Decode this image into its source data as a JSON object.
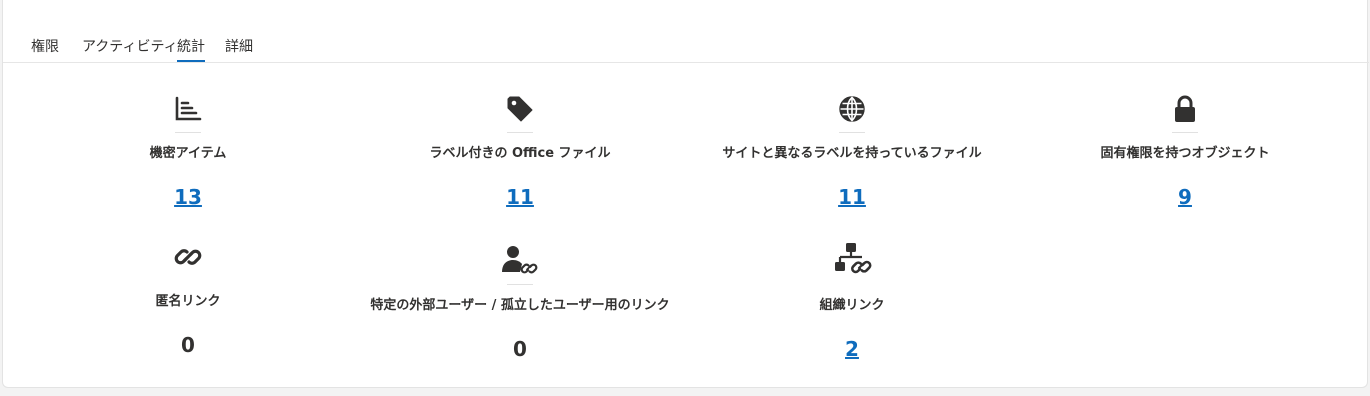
{
  "tabs": [
    {
      "label": "権限"
    },
    {
      "label": "アクティビティ"
    },
    {
      "label": "統計"
    },
    {
      "label": "詳細"
    }
  ],
  "active_tab": "統計",
  "accent_color": "#0f6cbd",
  "stats": [
    {
      "icon": "chart-icon",
      "label": "機密アイテム",
      "value": "13",
      "is_link": true
    },
    {
      "icon": "tag-icon",
      "label": "ラベル付きの Office ファイル",
      "value": "11",
      "is_link": true
    },
    {
      "icon": "globe-icon",
      "label": "サイトと異なるラベルを持っているファイル",
      "value": "11",
      "is_link": true
    },
    {
      "icon": "lock-icon",
      "label": "固有権限を持つオブジェクト",
      "value": "9",
      "is_link": true
    },
    {
      "icon": "link-icon",
      "label": "匿名リンク",
      "value": "0",
      "is_link": false
    },
    {
      "icon": "user-link-icon",
      "label": "特定の外部ユーザー / 孤立したユーザー用のリンク",
      "value": "0",
      "is_link": false
    },
    {
      "icon": "org-link-icon",
      "label": "組織リンク",
      "value": "2",
      "is_link": true
    }
  ]
}
